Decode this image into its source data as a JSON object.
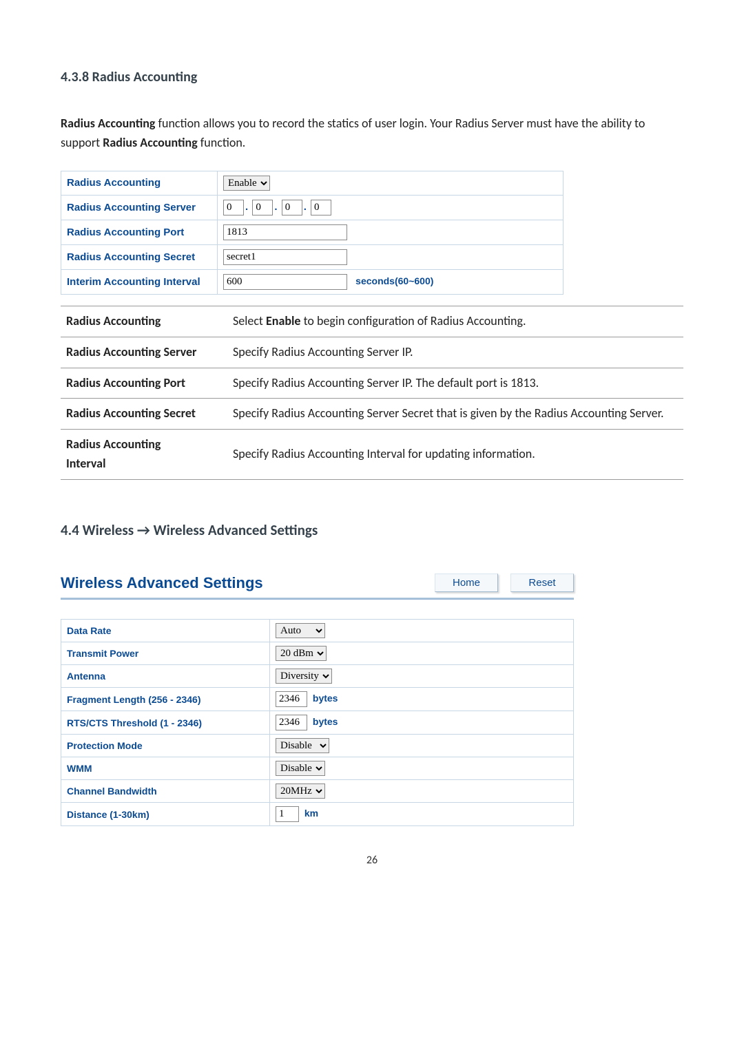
{
  "section_438": {
    "heading": "4.3.8 Radius Accounting",
    "intro_1_bold": "Radius Accounting",
    "intro_1_rest": " function allows you to record the statics of user login. Your Radius Server must have the ability to support ",
    "intro_2_bold": "Radius Accounting",
    "intro_2_rest": " function."
  },
  "radius_form": {
    "row1_label": "Radius Accounting",
    "row1_value": "Enable",
    "row2_label": "Radius Accounting Server",
    "row2_ip": [
      "0",
      "0",
      "0",
      "0"
    ],
    "row3_label": "Radius Accounting Port",
    "row3_value": "1813",
    "row4_label": "Radius Accounting Secret",
    "row4_value": "secret1",
    "row5_label": "Interim Accounting Interval",
    "row5_value": "600",
    "row5_hint": "seconds(60~600)"
  },
  "radius_desc": {
    "r1_term": "Radius Accounting",
    "r1_def_a": "Select ",
    "r1_def_b": "Enable",
    "r1_def_c": " to begin configuration of Radius Accounting.",
    "r2_term": "Radius Accounting Server",
    "r2_def": "Specify Radius Accounting Server IP.",
    "r3_term": "Radius Accounting Port",
    "r3_def": "Specify Radius Accounting Server IP. The default port is 1813.",
    "r4_term": "Radius Accounting Secret",
    "r4_def": "Specify Radius Accounting Server Secret that is given by the Radius Accounting Server.",
    "r5_term_a": "Radius Accounting",
    "r5_term_b": "Interval",
    "r5_def": "Specify Radius Accounting Interval for updating information."
  },
  "section_44_heading": "4.4 Wireless → Wireless Advanced Settings",
  "panel": {
    "title": "Wireless Advanced Settings",
    "home": "Home",
    "reset": "Reset"
  },
  "wadv": {
    "data_rate_label": "Data Rate",
    "data_rate_value": "Auto",
    "tx_power_label": "Transmit Power",
    "tx_power_value": "20 dBm",
    "antenna_label": "Antenna",
    "antenna_value": "Diversity",
    "frag_label": "Fragment Length (256 - 2346)",
    "frag_value": "2346",
    "frag_unit": "bytes",
    "rts_label": "RTS/CTS Threshold (1 - 2346)",
    "rts_value": "2346",
    "rts_unit": "bytes",
    "prot_label": "Protection Mode",
    "prot_value": "Disable",
    "wmm_label": "WMM",
    "wmm_value": "Disable",
    "cbw_label": "Channel Bandwidth",
    "cbw_value": "20MHz",
    "dist_label": "Distance (1-30km)",
    "dist_value": "1",
    "dist_unit": "km"
  },
  "page_number": "26"
}
